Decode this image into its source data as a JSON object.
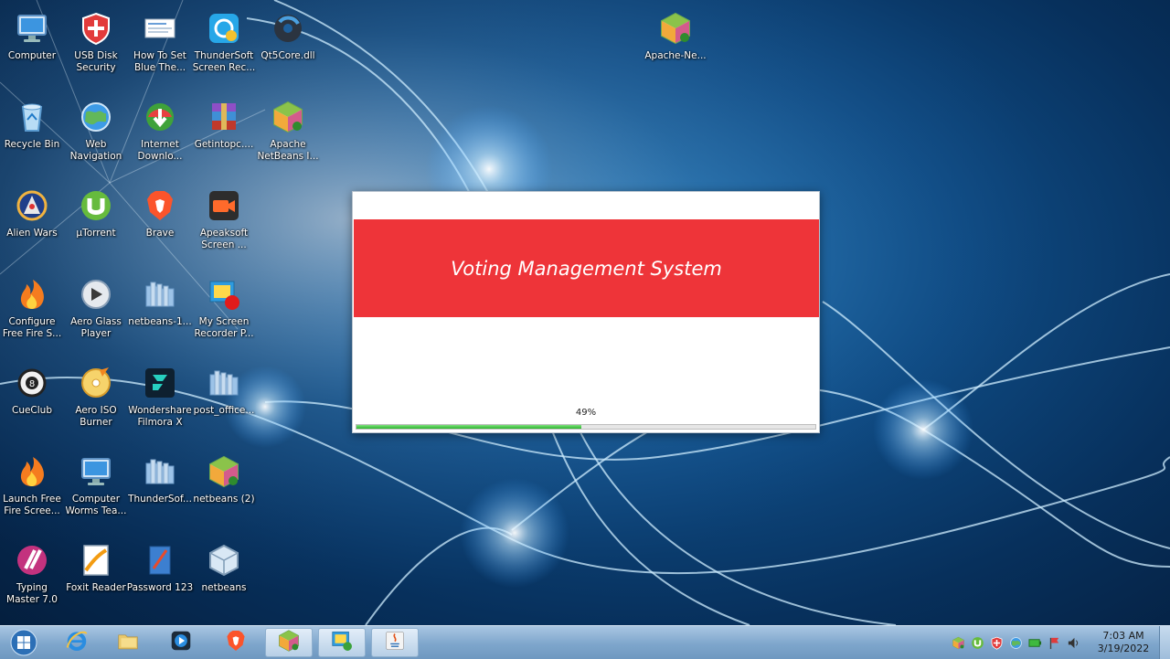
{
  "desktop_icons": [
    {
      "label": "Computer",
      "icon": "computer-icon"
    },
    {
      "label": "USB Disk\nSecurity",
      "icon": "shield-icon"
    },
    {
      "label": "How To Set\nBlue The...",
      "icon": "document-icon"
    },
    {
      "label": "ThunderSoft\nScreen Rec...",
      "icon": "screen-recorder-icon"
    },
    {
      "label": "Qt5Core.dll",
      "icon": "dll-icon"
    },
    {
      "label": "Apache-Ne...",
      "icon": "netbeans-icon"
    },
    {
      "label": "Recycle Bin",
      "icon": "recycle-bin-icon"
    },
    {
      "label": "Web\nNavigation",
      "icon": "globe-icon"
    },
    {
      "label": "Internet\nDownlo...",
      "icon": "internet-download-manager-icon"
    },
    {
      "label": "Getintopc....",
      "icon": "winrar-icon"
    },
    {
      "label": "Apache\nNetBeans I...",
      "icon": "netbeans-icon"
    },
    {
      "label": "Alien Wars",
      "icon": "game-icon"
    },
    {
      "label": "µTorrent",
      "icon": "utorrent-icon"
    },
    {
      "label": "Brave",
      "icon": "brave-icon"
    },
    {
      "label": "Apeaksoft\nScreen ...",
      "icon": "video-camera-icon"
    },
    {
      "label": "Configure\nFree Fire S...",
      "icon": "fire-icon"
    },
    {
      "label": "Aero Glass\nPlayer",
      "icon": "media-player-icon"
    },
    {
      "label": "netbeans-1...",
      "icon": "folder-icon"
    },
    {
      "label": "My Screen\nRecorder P...",
      "icon": "record-icon"
    },
    {
      "label": "CueClub",
      "icon": "cueclub-icon"
    },
    {
      "label": "Aero ISO\nBurner",
      "icon": "disc-icon"
    },
    {
      "label": "Wondershare\nFilmora X",
      "icon": "filmora-icon"
    },
    {
      "label": "post_office...",
      "icon": "folder-icon"
    },
    {
      "label": "Launch Free\nFire Scree...",
      "icon": "fire-icon"
    },
    {
      "label": "Computer\nWorms Tea...",
      "icon": "computer-icon"
    },
    {
      "label": "ThunderSof...",
      "icon": "folder-icon"
    },
    {
      "label": "netbeans (2)",
      "icon": "netbeans-icon"
    },
    {
      "label": "Typing\nMaster 7.0",
      "icon": "typing-master-icon"
    },
    {
      "label": "Foxit Reader",
      "icon": "foxit-icon"
    },
    {
      "label": "Password 123",
      "icon": "notebook-icon"
    },
    {
      "label": "netbeans",
      "icon": "cube-icon"
    }
  ],
  "splash": {
    "title": "Voting Management System",
    "progress_text": "49%",
    "progress": 0.49,
    "banner_color": "#ee3439",
    "bar_color": "#2fb52f"
  },
  "taskbar": {
    "start_icon": "windows-start-icon",
    "pinned": [
      {
        "icon": "internet-explorer-icon",
        "active": false
      },
      {
        "icon": "file-explorer-icon",
        "active": false
      },
      {
        "icon": "media-player-icon",
        "active": false
      },
      {
        "icon": "brave-icon",
        "active": false
      },
      {
        "icon": "netbeans-icon",
        "active": true
      },
      {
        "icon": "screen-recorder-icon",
        "active": true
      },
      {
        "icon": "java-icon",
        "active": true
      }
    ],
    "tray": [
      "netbeans-tray-icon",
      "utorrent-tray-icon",
      "shield-tray-icon",
      "network-globe-icon",
      "battery-icon",
      "flag-icon",
      "volume-icon"
    ],
    "clock_time": "7:03 AM",
    "clock_date": "3/19/2022"
  }
}
